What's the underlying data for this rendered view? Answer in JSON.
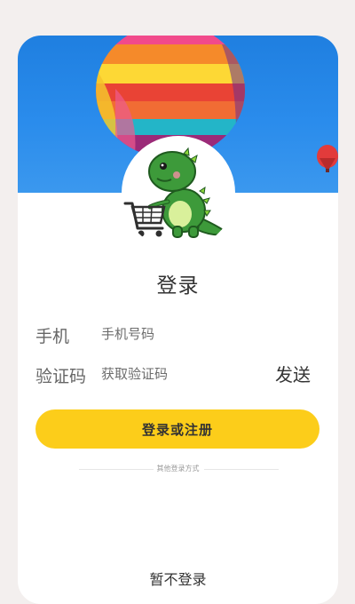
{
  "login": {
    "title": "登录",
    "phone": {
      "label": "手机",
      "placeholder": "手机号码",
      "value": ""
    },
    "code": {
      "label": "验证码",
      "placeholder": "获取验证码",
      "value": "",
      "send_label": "发送"
    },
    "submit_label": "登录或注册",
    "other_methods_label": "其他登录方式",
    "skip_label": "暂不登录"
  },
  "colors": {
    "accent": "#fccd1a",
    "banner_sky": "#2a8cec",
    "page_background": "#f3efee",
    "mascot_green": "#3d9a3a"
  },
  "icons": {
    "banner": "hot-air-balloon-image",
    "avatar": "dinosaur-shopping-cart-mascot"
  }
}
